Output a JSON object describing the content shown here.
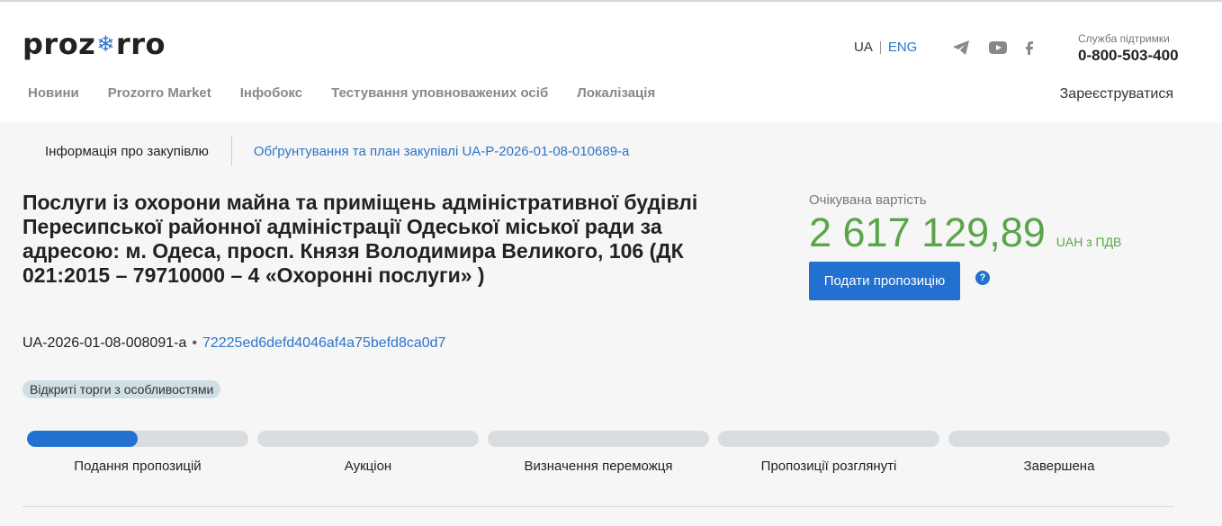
{
  "header": {
    "logo_left": "proz",
    "logo_snow": "❄",
    "logo_right": "rro",
    "lang_ua": "UA",
    "lang_eng": "ENG",
    "support_label": "Служба підтримки",
    "support_phone": "0-800-503-400",
    "register": "Зареєструватися",
    "nav": [
      "Новини",
      "Prozorro Market",
      "Інфобокс",
      "Тестування уповноважених осіб",
      "Локалізація"
    ],
    "social_icons": [
      "telegram-icon",
      "youtube-icon",
      "facebook-icon"
    ]
  },
  "tabs": {
    "info": "Інформація про закупівлю",
    "plan": "Обґрунтування та план закупівлі UA-P-2026-01-08-010689-a"
  },
  "tender": {
    "title": "Послуги із охорони майна та приміщень адміністративної будівлі Пересипської районної адміністрації Одеської міської ради за адресою: м. Одеса, просп. Князя Володимира Великого, 106 (ДК 021:2015 – 79710000 – 4 «Охоронні послуги» )",
    "id": "UA-2026-01-08-008091-a",
    "separator": "•",
    "hash": "72225ed6defd4046af4a75befd8ca0d7",
    "badge": "Відкриті торги з особливостями"
  },
  "price": {
    "label": "Очікувана вартість",
    "amount": "2 617 129,89",
    "currency": "UAH з ПДВ",
    "submit": "Подати пропозицію",
    "help": "?"
  },
  "stages": [
    {
      "label": "Подання пропозицій",
      "progress": 0.5
    },
    {
      "label": "Аукціон",
      "progress": 0
    },
    {
      "label": "Визначення переможця",
      "progress": 0
    },
    {
      "label": "Пропозиції розглянуті",
      "progress": 0
    },
    {
      "label": "Завершена",
      "progress": 0
    }
  ],
  "colors": {
    "accent": "#2270cf",
    "price": "#5aa54a",
    "badge": "#cfdfe6"
  }
}
